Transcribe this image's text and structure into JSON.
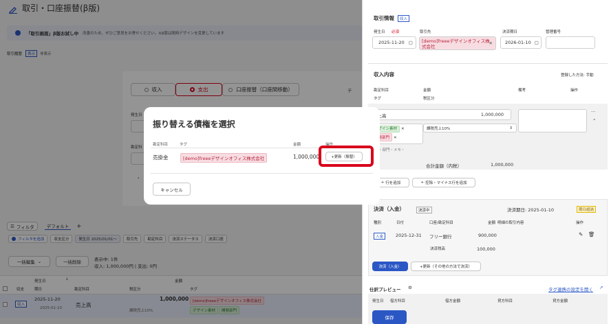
{
  "left": {
    "title": "取引・口座振替(β版)",
    "notice": {
      "badge": "「取引画面」β版お試し中",
      "text": "改善のため、ぜひご意見をお寄せください。※β版は随時デザインを変更しています"
    },
    "history": {
      "label": "取引履歴",
      "show": "表示",
      "hide": "非表示"
    },
    "type_tabs": [
      {
        "label": "収入",
        "selected": false
      },
      {
        "label": "支出",
        "selected": true
      },
      {
        "label": "口座振替（口座間移動）",
        "selected": false
      }
    ],
    "partial": {
      "te": "テ",
      "hass": "発生日",
      "kan": "勘定科"
    },
    "filter": {
      "button": "フィルタ",
      "default_tab": "デフォルト",
      "add": "+",
      "add_filter": "フィルタを追加"
    },
    "filter_chips": [
      "収支区分",
      "発生日 2025/01/01〜",
      "取引先",
      "勘定科目",
      "決済ステータス",
      "決済口座"
    ],
    "bulk": {
      "edit": "一括編集",
      "release": "一括削除"
    },
    "summary": {
      "count": "表示中: 1件",
      "totals": "収入: 1,000,000円 | 支出: 0円"
    },
    "table": {
      "headers": {
        "type": "収支",
        "date_top": "発生日",
        "date_bottom": "期日",
        "account": "勘定科目",
        "account_sub": "税区分",
        "amount": "金額",
        "tag": "タグ"
      },
      "row": {
        "type": "収入",
        "date": "2025-11-20",
        "due": "2025-01-10",
        "account": "売上高",
        "amount": "1,000,000",
        "tax": "課税売上10%",
        "tags": [
          "[demo]freeeデザインオフィス株式会社",
          "デザイン素材",
          "開発部門"
        ]
      }
    }
  },
  "modal": {
    "title": "振り替える債権を選択",
    "columns": [
      "勘定科目",
      "タグ",
      "金額",
      "操作"
    ],
    "row": {
      "account": "売掛金",
      "tag": "[demo]freeeデザインオフィス株式会社",
      "amount": "1,000,000",
      "action": "+更新（振替）"
    },
    "cancel": "キャンセル",
    "highlight_color": "#d9001b"
  },
  "right": {
    "info": {
      "title": "取引情報",
      "badge": "収入",
      "labels": {
        "date": "発生日",
        "required": "必須",
        "partner": "取引先",
        "due": "決済期日",
        "mgmt": "管理番号"
      },
      "date": "2025-11-20",
      "partner": "[demo]freeeデザインオフィス株式会社",
      "due": "2026-01-10"
    },
    "income": {
      "title": "収入内容",
      "method": "登録した方法: 手動",
      "headers": {
        "account": "勘定科目",
        "amount": "金額",
        "note": "備考",
        "action": "操作",
        "tag": "タグ",
        "tax": "税区分"
      },
      "row": {
        "account": "売上高",
        "amount": "1,000,000",
        "tags": [
          "デザイン素材",
          "開発部門"
        ],
        "tax": "課税売上10%",
        "more": "品目・部門・メモ・"
      },
      "total_label": "合計金額（内税）",
      "total": "1,000,000",
      "add_row": "行を追加",
      "add_deduct": "控除・マイナス行を追加"
    },
    "settlement": {
      "title": "決済（入金）",
      "status": "決済中",
      "due_label": "決済期日: 2025-01-10",
      "overdue": "期日超過",
      "headers": [
        "種別",
        "日付",
        "口座/勘定科目",
        "金額",
        "明細の取引内容",
        "操作"
      ],
      "row": {
        "type": "入金",
        "date": "2025-12-31",
        "account": "フリー銀行",
        "amount": "900,000"
      },
      "unpaid_label": "決済残高",
      "unpaid": "100,000",
      "btn_primary": "決済（入金）",
      "btn_secondary": "+更新（その他の方法で決済）"
    },
    "journal": {
      "title": "仕訳プレビュー",
      "link": "タグ連携の設定を開く",
      "headers": [
        "発生日",
        "借方科目",
        "借方金額",
        "貸方科目",
        "貸方金額"
      ]
    },
    "save": "保存"
  },
  "colors": {
    "accent": "#2b57c5",
    "danger": "#d9001b",
    "primary": "#2b57c5"
  }
}
